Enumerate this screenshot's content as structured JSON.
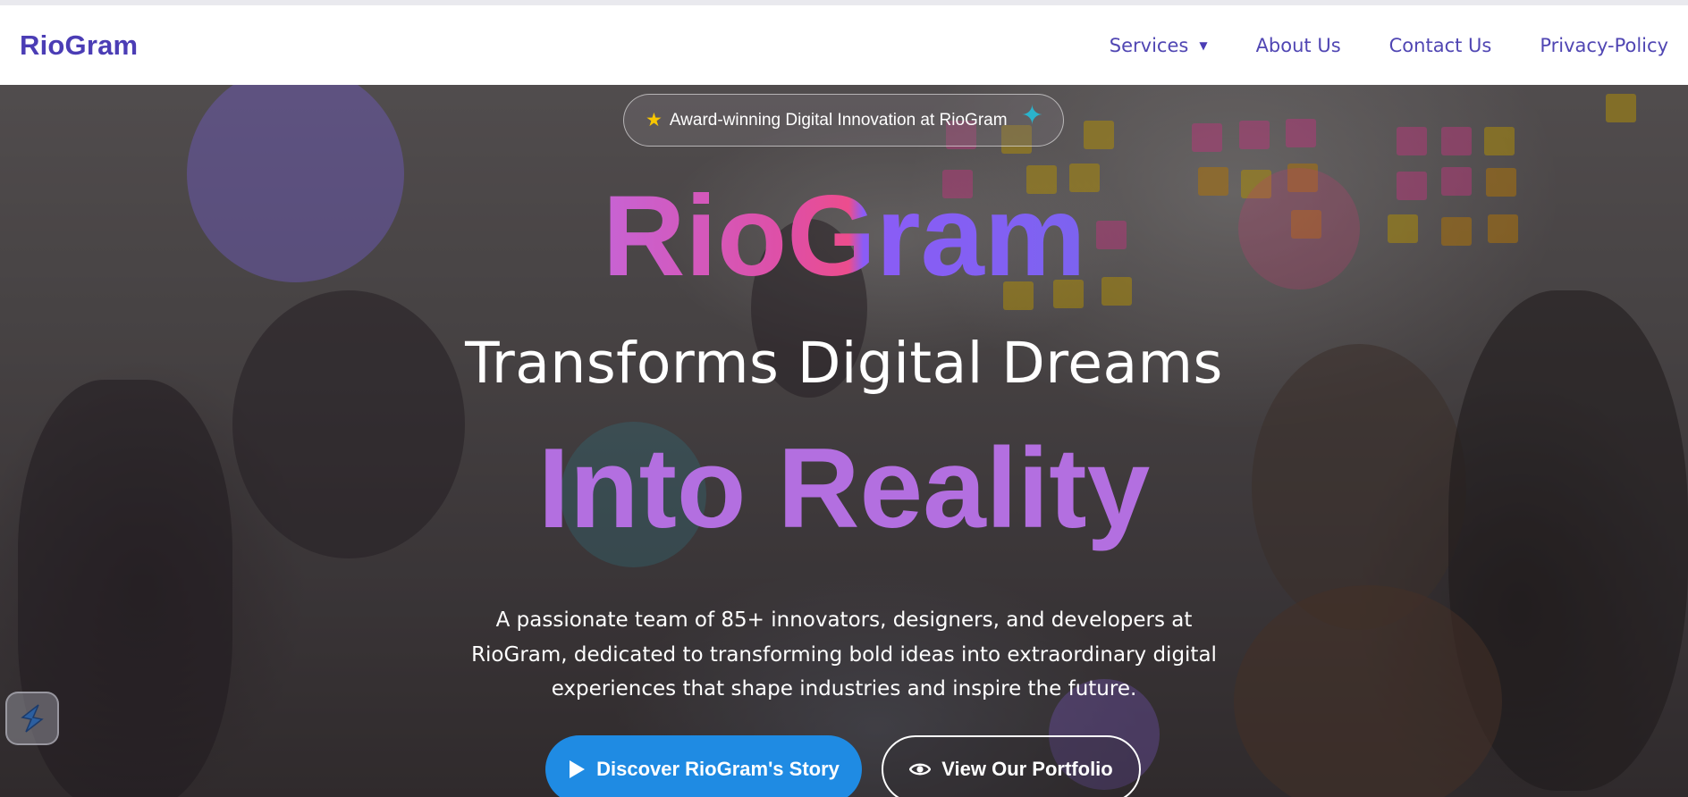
{
  "nav": {
    "logo": "RioGram",
    "links": [
      {
        "label": "Services",
        "has_dropdown": true
      },
      {
        "label": "About Us"
      },
      {
        "label": "Contact Us"
      },
      {
        "label": "Privacy-Policy"
      }
    ],
    "dropdown_caret": "▼"
  },
  "hero": {
    "badge": {
      "icon": "star-icon",
      "text": "Award-winning Digital Innovation at RioGram",
      "sparkle_icon": "sparkle-icon"
    },
    "brand_title": "RioGram",
    "subtitle": "Transforms Digital Dreams",
    "highlight": "Into Reality",
    "description": "A passionate team of 85+ innovators, designers, and developers at RioGram, dedicated to transforming bold ideas into extraordinary digital experiences that shape industries and inspire the future.",
    "buttons": {
      "primary": {
        "label": "Discover RioGram's Story",
        "icon": "play-icon"
      },
      "secondary": {
        "label": "View Our Portfolio",
        "icon": "eye-icon"
      }
    }
  },
  "colors": {
    "brand": "#4b3db5",
    "nav_link": "#5046b3",
    "primary_button": "#1f8be3",
    "highlight_text": "#b36fe0",
    "gradient_start": "#c763d4",
    "gradient_end": "#7c63f0"
  },
  "side_widget": {
    "icon": "side-widget-s-icon"
  }
}
